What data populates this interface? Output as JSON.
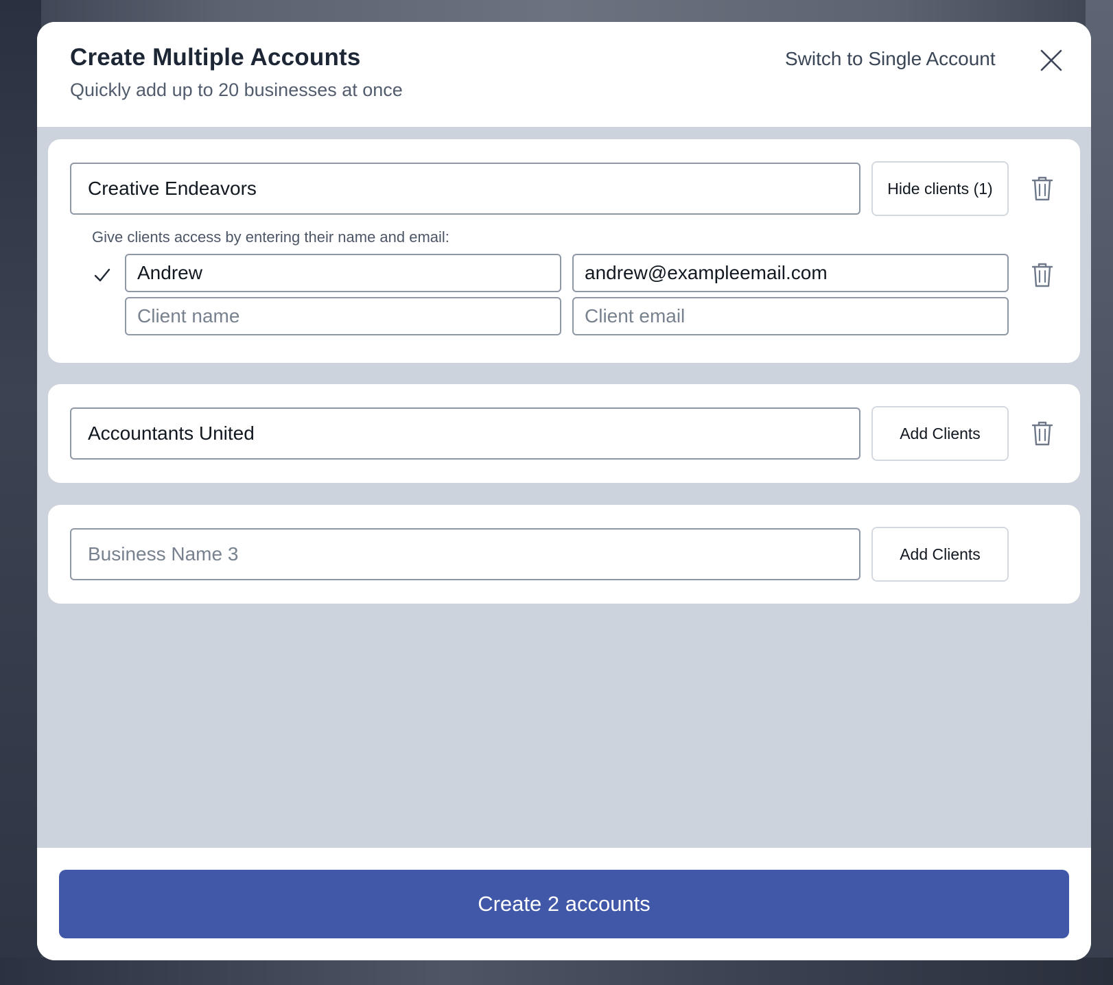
{
  "modal": {
    "title": "Create Multiple Accounts",
    "subtitle": "Quickly add up to 20 businesses at once",
    "switch_link": "Switch to Single Account"
  },
  "icons": {
    "close": "close-icon",
    "trash": "trash-icon",
    "check": "check-icon"
  },
  "businesses": [
    {
      "name": "Creative Endeavors",
      "toggle_label": "Hide clients (1)",
      "access_label": "Give clients access by entering their name and email:",
      "clients": [
        {
          "name": "Andrew",
          "email": "andrew@exampleemail.com"
        },
        {
          "name_placeholder": "Client name",
          "email_placeholder": "Client email"
        }
      ]
    },
    {
      "name": "Accountants United",
      "toggle_label": "Add Clients"
    },
    {
      "placeholder": "Business Name 3",
      "toggle_label": "Add Clients"
    }
  ],
  "footer": {
    "submit_label": "Create 2 accounts"
  },
  "colors": {
    "primary": "#4157a8",
    "body_bg": "#ccd3dc"
  }
}
